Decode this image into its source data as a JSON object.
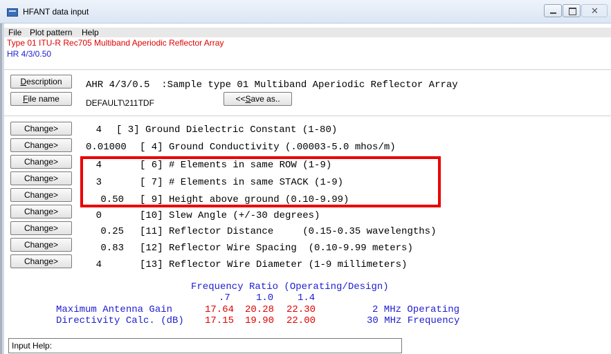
{
  "window": {
    "title": "HFANT data input"
  },
  "menu": [
    "File",
    "Plot pattern",
    "Help"
  ],
  "header": {
    "type_line": "Type 01 ITU-R Rec705 Multiband Aperiodic Reflector Array",
    "design_line": "HR 4/3/0.50"
  },
  "description": {
    "button_label": "Description",
    "button_underline": "D",
    "button_rest": "escription",
    "text": "AHR 4/3/0.5  :Sample type 01 Multiband Aperiodic Reflector Array"
  },
  "filename": {
    "button_underline": "F",
    "button_rest": "ile name",
    "value": "DEFAULT\\211TDF",
    "save_prefix": "<<",
    "save_underline": "S",
    "save_rest": "ave as.."
  },
  "change_label": "Change>",
  "params": [
    {
      "value": "4",
      "text": "[ 3] Ground Dielectric Constant (1-80)"
    },
    {
      "value": "0.01000",
      "text": "[ 4] Ground Conductivity (.00003-5.0 mhos/m)"
    },
    {
      "value": "4",
      "text": "[ 6] # Elements in same ROW (1-9)"
    },
    {
      "value": "3",
      "text": "[ 7] # Elements in same STACK (1-9)"
    },
    {
      "value": "0.50",
      "text": "[ 9] Height above ground (0.10-9.99)"
    },
    {
      "value": "0",
      "text": "[10] Slew Angle (+/-30 degrees)"
    },
    {
      "value": "0.25",
      "text": "[11] Reflector Distance     (0.15-0.35 wavelengths)"
    },
    {
      "value": "0.83",
      "text": "[12] Reflector Wire Spacing  (0.10-9.99 meters)"
    },
    {
      "value": "4",
      "text": "[13] Reflector Wire Diameter (1-9 millimeters)"
    }
  ],
  "frequency": {
    "heading": "Frequency Ratio (Operating/Design)",
    "ratios": [
      ".7",
      "1.0",
      "1.4"
    ],
    "gain_label": "Maximum Antenna Gain",
    "gain_values": [
      "17.64",
      "20.28",
      "22.30"
    ],
    "gain_note": "2 MHz Operating",
    "dir_label": "Directivity Calc. (dB)",
    "dir_values": [
      "17.15",
      "19.90",
      "22.00"
    ],
    "dir_note": "30 MHz Frequency"
  },
  "input_help": {
    "label": "Input Help:"
  }
}
